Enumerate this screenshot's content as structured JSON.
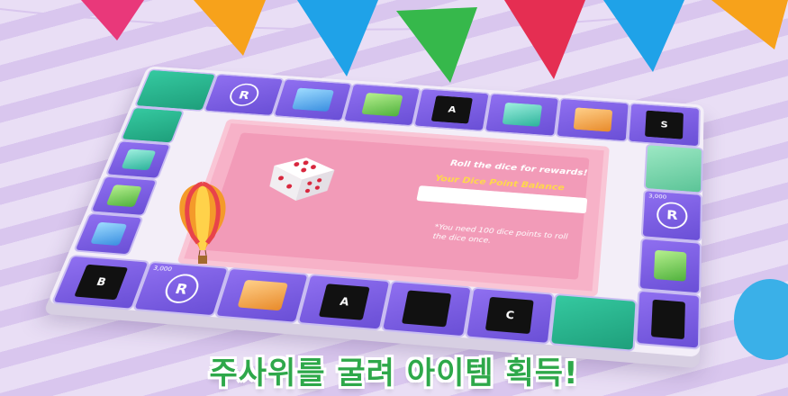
{
  "board": {
    "prompt": "Roll the dice for rewards!",
    "balance_label": "Your Dice Point Balance",
    "balance_value": "",
    "note": "*You need 100 dice points to roll the dice once."
  },
  "tiles": {
    "top": [
      {
        "kind": "green",
        "label": ""
      },
      {
        "kind": "reward",
        "label": "R"
      },
      {
        "kind": "pack-blue",
        "label": ""
      },
      {
        "kind": "pack-green",
        "label": ""
      },
      {
        "kind": "card",
        "label": "A"
      },
      {
        "kind": "pack-teal",
        "label": ""
      },
      {
        "kind": "pack-orange",
        "label": ""
      },
      {
        "kind": "card",
        "label": "S"
      }
    ],
    "right": [
      {
        "kind": "carousel",
        "label": ""
      },
      {
        "kind": "reward",
        "label": "R",
        "amount": "3,000"
      },
      {
        "kind": "pack-green",
        "label": ""
      },
      {
        "kind": "card",
        "label": ""
      }
    ],
    "bottom": [
      {
        "kind": "card",
        "label": "B"
      },
      {
        "kind": "reward",
        "label": "R",
        "amount": "3,000"
      },
      {
        "kind": "pack-orange",
        "label": ""
      },
      {
        "kind": "card",
        "label": "A"
      },
      {
        "kind": "card",
        "label": ""
      },
      {
        "kind": "card",
        "label": "C"
      },
      {
        "kind": "green",
        "label": ""
      }
    ],
    "left": [
      {
        "kind": "green",
        "label": ""
      },
      {
        "kind": "pack-teal",
        "label": ""
      },
      {
        "kind": "pack-green",
        "label": ""
      },
      {
        "kind": "pack-blue",
        "label": ""
      }
    ]
  },
  "caption": "주사위를 굴려 아이템 획득!",
  "colors": {
    "tile": "#7a5ce4",
    "panel": "#f29bb8",
    "caption": "#2ea84a",
    "balance_label": "#ffd84a"
  }
}
